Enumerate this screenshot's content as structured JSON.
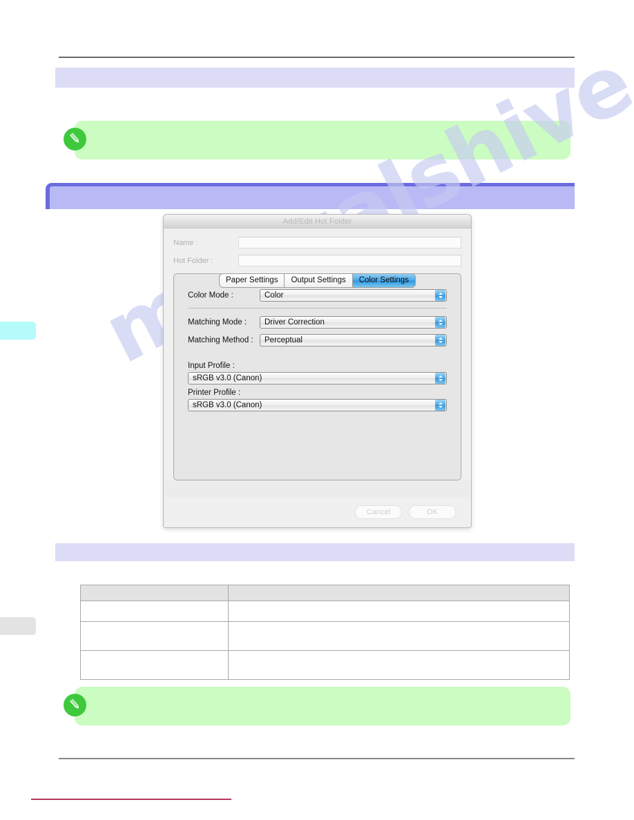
{
  "watermark": {
    "text": "manualshive.com"
  },
  "page": {
    "section_bars": [
      {
        "name": "bar-top",
        "color": "#dcdcf7",
        "text": ""
      },
      {
        "name": "bar-mid",
        "color": "#dcdcf7",
        "text": ""
      }
    ],
    "heading_bar": {
      "text": "",
      "fill": "#b9b9f6",
      "accent": "#6b6be0"
    },
    "margin_tabs": [
      {
        "name": "margin-tab-cyan",
        "color": "#b6fbfb",
        "label": ""
      },
      {
        "name": "margin-tab-gray",
        "color": "#e3e3e3",
        "label": ""
      }
    ],
    "notes": [
      {
        "icon": "memo-pencil-icon",
        "text": ""
      },
      {
        "icon": "memo-pencil-icon",
        "text": ""
      }
    ],
    "footer_rule_color": "#b4365a"
  },
  "spec_table": {
    "headers": [
      "",
      ""
    ],
    "rows": [
      [
        "",
        ""
      ],
      [
        "",
        ""
      ],
      [
        "",
        ""
      ]
    ]
  },
  "dialog": {
    "title": "Add/Edit Hot Folder",
    "fields": [
      {
        "label": "Name :",
        "value": "",
        "placeholder": ""
      },
      {
        "label": "Hot Folder :",
        "value": "",
        "placeholder": ""
      }
    ],
    "tabs": [
      {
        "label": "Paper Settings",
        "selected": false
      },
      {
        "label": "Output Settings",
        "selected": false
      },
      {
        "label": "Color Settings",
        "selected": true
      }
    ],
    "color_settings": {
      "color_mode": {
        "label": "Color Mode :",
        "value": "Color"
      },
      "matching_mode": {
        "label": "Matching Mode :",
        "value": "Driver Correction"
      },
      "matching_method": {
        "label": "Matching Method :",
        "value": "Perceptual"
      },
      "input_profile": {
        "label": "Input Profile :",
        "value": "sRGB v3.0 (Canon)"
      },
      "printer_profile": {
        "label": "Printer Profile :",
        "value": "sRGB v3.0 (Canon)"
      }
    },
    "buttons": {
      "cancel": "Cancel",
      "ok": "OK"
    },
    "accent_blue": "#3598dc"
  }
}
